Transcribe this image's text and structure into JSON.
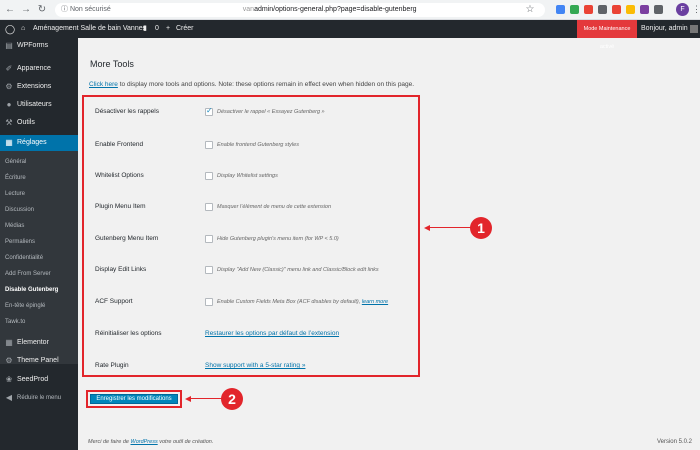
{
  "browser": {
    "insecure_label": "Non sécurisé",
    "url_path": "admin/options-general.php?page=disable-gutenberg",
    "url_domain": "van",
    "profile_initial": "F"
  },
  "admin_bar": {
    "site_name": "Aménagement Salle de bain Vannes",
    "comments_count": "0",
    "new_label": "Créer",
    "maintenance_label": "Mode Maintenance activé",
    "greeting": "Bonjour, admin"
  },
  "sidebar": {
    "items_top": [
      {
        "label": "WPForms",
        "icon": "wpforms-icon"
      },
      {
        "label": "Apparence",
        "icon": "appearance-icon"
      },
      {
        "label": "Extensions",
        "icon": "plugins-icon"
      },
      {
        "label": "Utilisateurs",
        "icon": "users-icon"
      },
      {
        "label": "Outils",
        "icon": "tools-icon"
      },
      {
        "label": "Réglages",
        "icon": "settings-icon"
      }
    ],
    "sub_items": [
      "Général",
      "Écriture",
      "Lecture",
      "Discussion",
      "Médias",
      "Permaliens",
      "Confidentialité",
      "Add From Server",
      "Disable Gutenberg",
      "En-tête épinglé",
      "Tawk.to"
    ],
    "items_bottom": [
      {
        "label": "Elementor",
        "icon": "elementor-icon"
      },
      {
        "label": "Theme Panel",
        "icon": "theme-panel-icon"
      },
      {
        "label": "SeedProd",
        "icon": "seedprod-icon"
      },
      {
        "label": "Réduire le menu",
        "icon": "collapse-icon"
      }
    ]
  },
  "main": {
    "title": "More Tools",
    "intro_link": "Click here",
    "intro_text": " to display more tools and options. Note: these options remain in effect even when hidden on this page.",
    "rows": [
      {
        "label": "Désactiver les rappels",
        "checked": true,
        "desc": "Désactiver le rappel « Essayez Gutenberg »"
      },
      {
        "label": "Enable Frontend",
        "checked": false,
        "desc": "Enable frontend Gutenberg styles"
      },
      {
        "label": "Whitelist Options",
        "checked": false,
        "desc": "Display Whitelist settings"
      },
      {
        "label": "Plugin Menu Item",
        "checked": false,
        "desc": "Masquer l’élément de menu de cette extension"
      },
      {
        "label": "Gutenberg Menu Item",
        "checked": false,
        "desc": "Hide Gutenberg plugin's menu item (for WP < 5.0)"
      },
      {
        "label": "Display Edit Links",
        "checked": false,
        "desc": "Display \"Add New (Classic)\" menu link and Classic/Block edit links"
      },
      {
        "label": "ACF Support",
        "checked": false,
        "desc": "Enable Custom Fields Meta Box (ACF disables by default),",
        "desc_link": "learn more"
      }
    ],
    "reset_label": "Réinitialiser les options",
    "reset_link": "Restaurer les options par défaut de l’extension",
    "rate_label": "Rate Plugin",
    "rate_link": "Show support with a 5-star rating »",
    "save_button": "Enregistrer les modifications",
    "badge_1": "1",
    "badge_2": "2",
    "footer_prefix": "Merci de faire de ",
    "footer_link": "WordPress",
    "footer_suffix": " votre outil de création.",
    "version": "Version 5.0.2"
  },
  "colors": {
    "accent": "#0073aa",
    "annotation_red": "#e2252b",
    "admin_bar": "#23282d"
  }
}
